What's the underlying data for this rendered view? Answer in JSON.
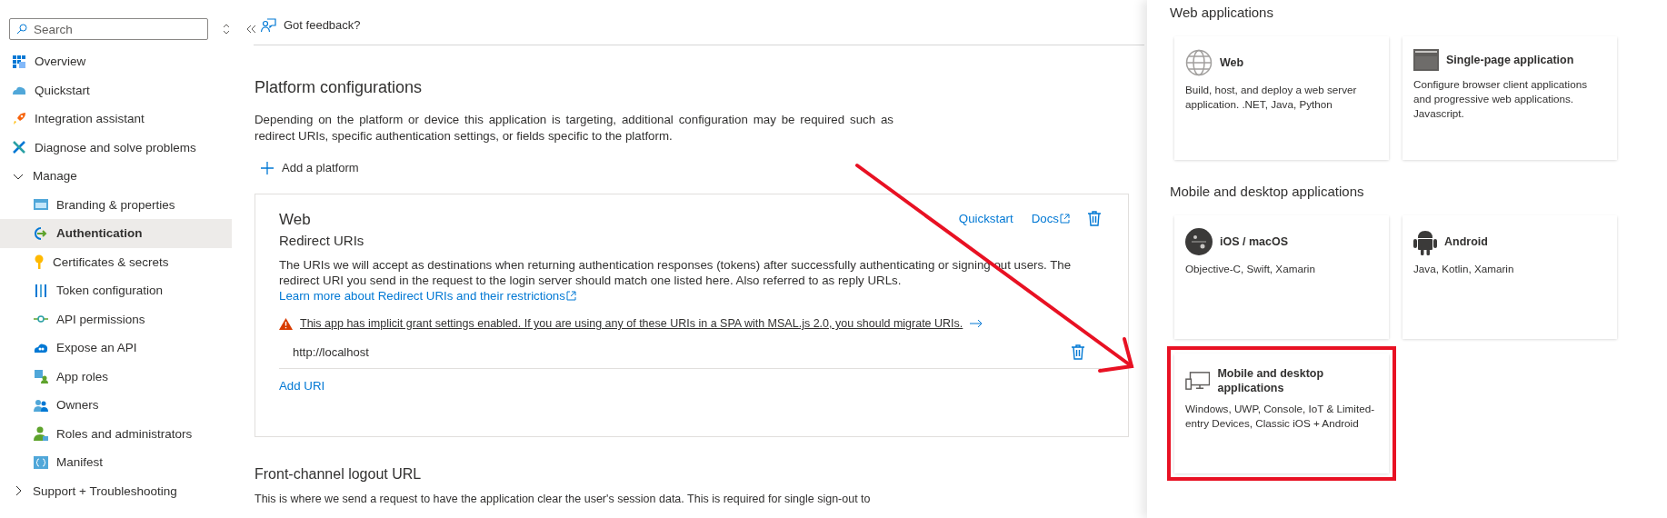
{
  "sidebar": {
    "search": {
      "placeholder": "Search"
    },
    "items": [
      {
        "label": "Overview",
        "selected": false
      },
      {
        "label": "Quickstart",
        "selected": false
      },
      {
        "label": "Integration assistant",
        "selected": false
      },
      {
        "label": "Diagnose and solve problems",
        "selected": false
      },
      {
        "label": "Manage",
        "selected": false,
        "expanded": true,
        "children": [
          {
            "label": "Branding & properties",
            "selected": false
          },
          {
            "label": "Authentication",
            "selected": true
          },
          {
            "label": "Certificates & secrets",
            "selected": false
          },
          {
            "label": "Token configuration",
            "selected": false
          },
          {
            "label": "API permissions",
            "selected": false
          },
          {
            "label": "Expose an API",
            "selected": false
          },
          {
            "label": "App roles",
            "selected": false
          },
          {
            "label": "Owners",
            "selected": false
          },
          {
            "label": "Roles and administrators",
            "selected": false
          },
          {
            "label": "Manifest",
            "selected": false
          }
        ]
      },
      {
        "label": "Support + Troubleshooting",
        "selected": false,
        "expanded": false
      }
    ]
  },
  "main": {
    "feedback": "Got feedback?",
    "title": "Platform configurations",
    "description": "Depending on the platform or device this application is targeting, additional configuration may be required such as redirect URIs, specific authentication settings, or fields specific to the platform.",
    "add_platform": "Add a platform",
    "web_card": {
      "title": "Web",
      "subtitle": "Redirect URIs",
      "quickstart": "Quickstart",
      "docs": "Docs",
      "text": "The URIs we will accept as destinations when returning authentication responses (tokens) after successfully authenticating or signing out users. The redirect URI you send in the request to the login server should match one listed here. Also referred to as reply URLs.",
      "link": "Learn more about Redirect URIs and their restrictions",
      "warning": "This app has implicit grant settings enabled. If you are using any of these URIs in a SPA with MSAL.js 2.0, you should migrate URIs.",
      "uris": [
        {
          "value": "http://localhost"
        }
      ],
      "add_uri": "Add URI"
    },
    "logout": {
      "title": "Front-channel logout URL",
      "text": "This is where we send a request to have the application clear the user's session data. This is required for single sign-out to"
    }
  },
  "panel": {
    "sections": [
      {
        "title": "Web applications",
        "cards": [
          {
            "title": "Web",
            "description": "Build, host, and deploy a web server application. .NET, Java, Python",
            "highlighted": false
          },
          {
            "title": "Single-page application",
            "description": "Configure browser client applications and progressive web applications. Javascript.",
            "highlighted": false
          }
        ]
      },
      {
        "title": "Mobile and desktop applications",
        "cards": [
          {
            "title": "iOS / macOS",
            "description": "Objective-C, Swift, Xamarin",
            "highlighted": false
          },
          {
            "title": "Android",
            "description": "Java, Kotlin, Xamarin",
            "highlighted": false
          },
          {
            "title": "Mobile and desktop applications",
            "description": "Windows, UWP, Console, IoT & Limited-entry Devices, Classic iOS + Android",
            "highlighted": true
          }
        ]
      }
    ]
  }
}
